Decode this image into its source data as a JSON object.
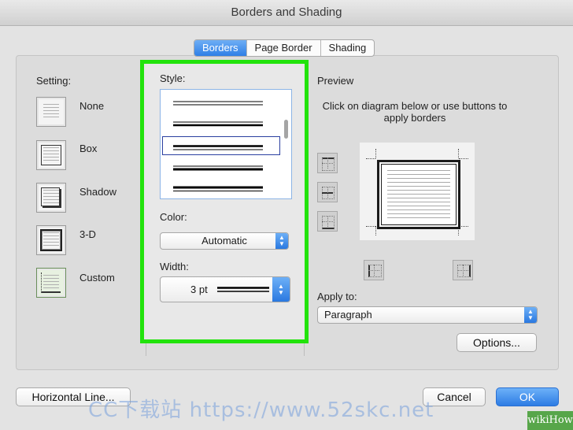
{
  "window": {
    "title": "Borders and Shading"
  },
  "tabs": [
    {
      "label": "Borders",
      "active": true
    },
    {
      "label": "Page Border",
      "active": false
    },
    {
      "label": "Shading",
      "active": false
    }
  ],
  "setting": {
    "label": "Setting:",
    "options": [
      {
        "label": "None"
      },
      {
        "label": "Box"
      },
      {
        "label": "Shadow"
      },
      {
        "label": "3-D"
      },
      {
        "label": "Custom",
        "selected": true
      }
    ]
  },
  "style": {
    "label": "Style:",
    "selected_index": 2
  },
  "color": {
    "label": "Color:",
    "value": "Automatic"
  },
  "width": {
    "label": "Width:",
    "value": "3 pt"
  },
  "preview": {
    "title": "Preview",
    "instructions": "Click on diagram below or use buttons to apply borders"
  },
  "apply_to": {
    "label": "Apply to:",
    "value": "Paragraph"
  },
  "buttons": {
    "options": "Options...",
    "horizontal_line": "Horizontal Line...",
    "cancel": "Cancel",
    "ok": "OK"
  },
  "overlay": {
    "watermark": "CC下载站 https://www.52skc.net",
    "badge": "wikiHow"
  },
  "colors": {
    "highlight": "#22e30c",
    "accent": "#2f7fe6"
  }
}
